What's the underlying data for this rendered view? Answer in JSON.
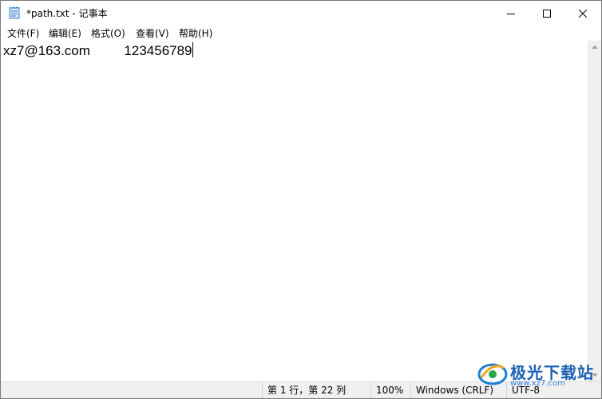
{
  "window": {
    "title": "*path.txt - 记事本",
    "controls": {
      "minimize": "minimize",
      "maximize": "maximize",
      "close": "close"
    }
  },
  "menu": {
    "file": "文件(F)",
    "edit": "编辑(E)",
    "format": "格式(O)",
    "view": "查看(V)",
    "help": "帮助(H)"
  },
  "editor": {
    "content": "xz7@163.com         123456789"
  },
  "status": {
    "position": "第 1 行，第 22 列",
    "zoom": "100%",
    "line_ending": "Windows (CRLF)",
    "encoding": "UTF-8"
  },
  "watermark": {
    "brand": "极光下载站",
    "url": "www.xz7.com"
  },
  "icons": {
    "app": "notepad-icon",
    "minimize": "minimize-icon",
    "maximize": "maximize-icon",
    "close": "close-icon"
  }
}
